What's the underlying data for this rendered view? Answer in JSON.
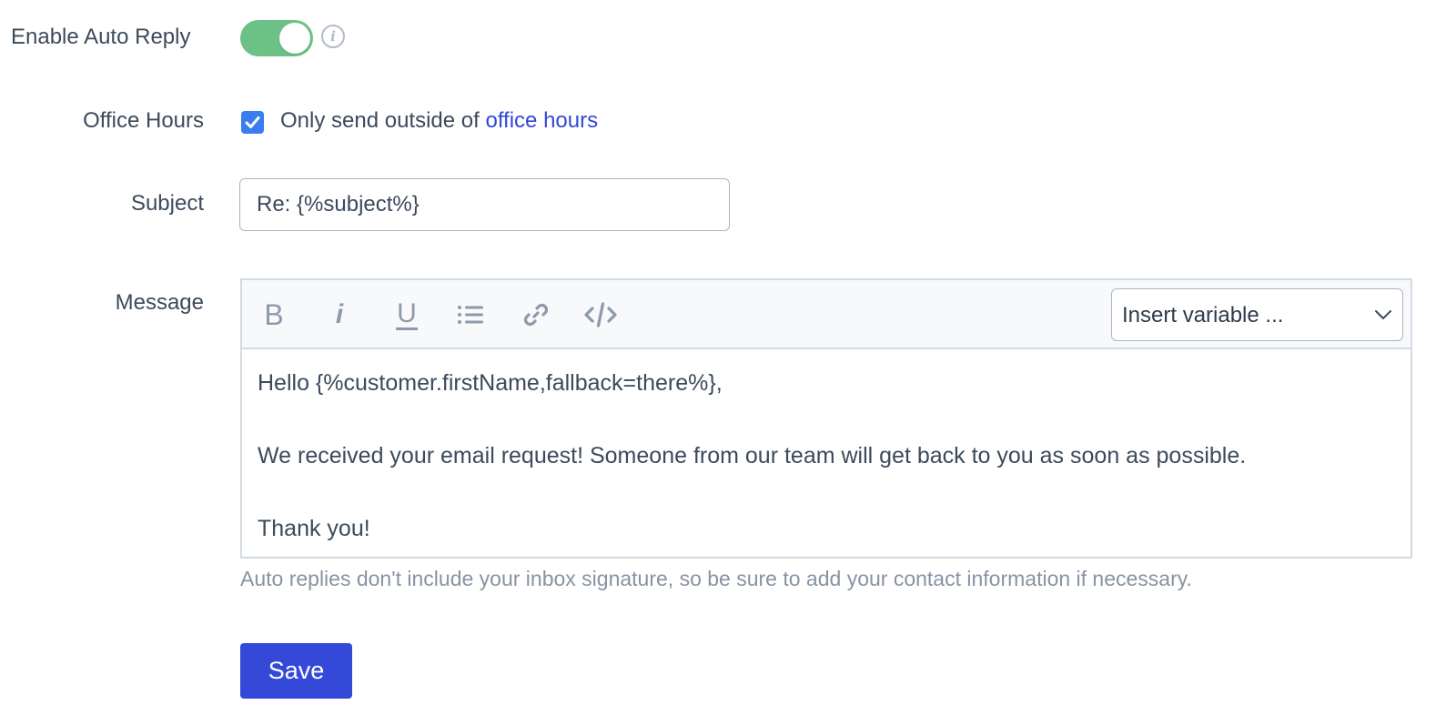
{
  "auto_reply": {
    "label": "Enable Auto Reply",
    "enabled": true,
    "toggle_color": "#6cc286",
    "info_icon": "info-icon",
    "info_glyph": "i"
  },
  "office_hours": {
    "label": "Office Hours",
    "checked": true,
    "text": "Only send outside of ",
    "link_text": "office hours",
    "checkbox_color": "#3b7cf0",
    "link_color": "#3248d6"
  },
  "subject": {
    "label": "Subject",
    "value": "Re: {%subject%}"
  },
  "message": {
    "label": "Message",
    "toolbar": {
      "bold": "B",
      "italic": "i",
      "underline": "U",
      "list_icon": "bulleted-list-icon",
      "link_icon": "link-icon",
      "code_icon": "code-icon"
    },
    "insert_variable": {
      "selected": "Insert variable ..."
    },
    "body": {
      "lines": [
        "Hello {%customer.firstName,fallback=there%},",
        "",
        "We received your email request! Someone from our team will get back to you as soon as possible.",
        "",
        "Thank you!"
      ]
    },
    "hint": "Auto replies don't include your inbox signature, so be sure to add your contact information if necessary."
  },
  "actions": {
    "save_label": "Save",
    "save_color": "#3549d8"
  }
}
